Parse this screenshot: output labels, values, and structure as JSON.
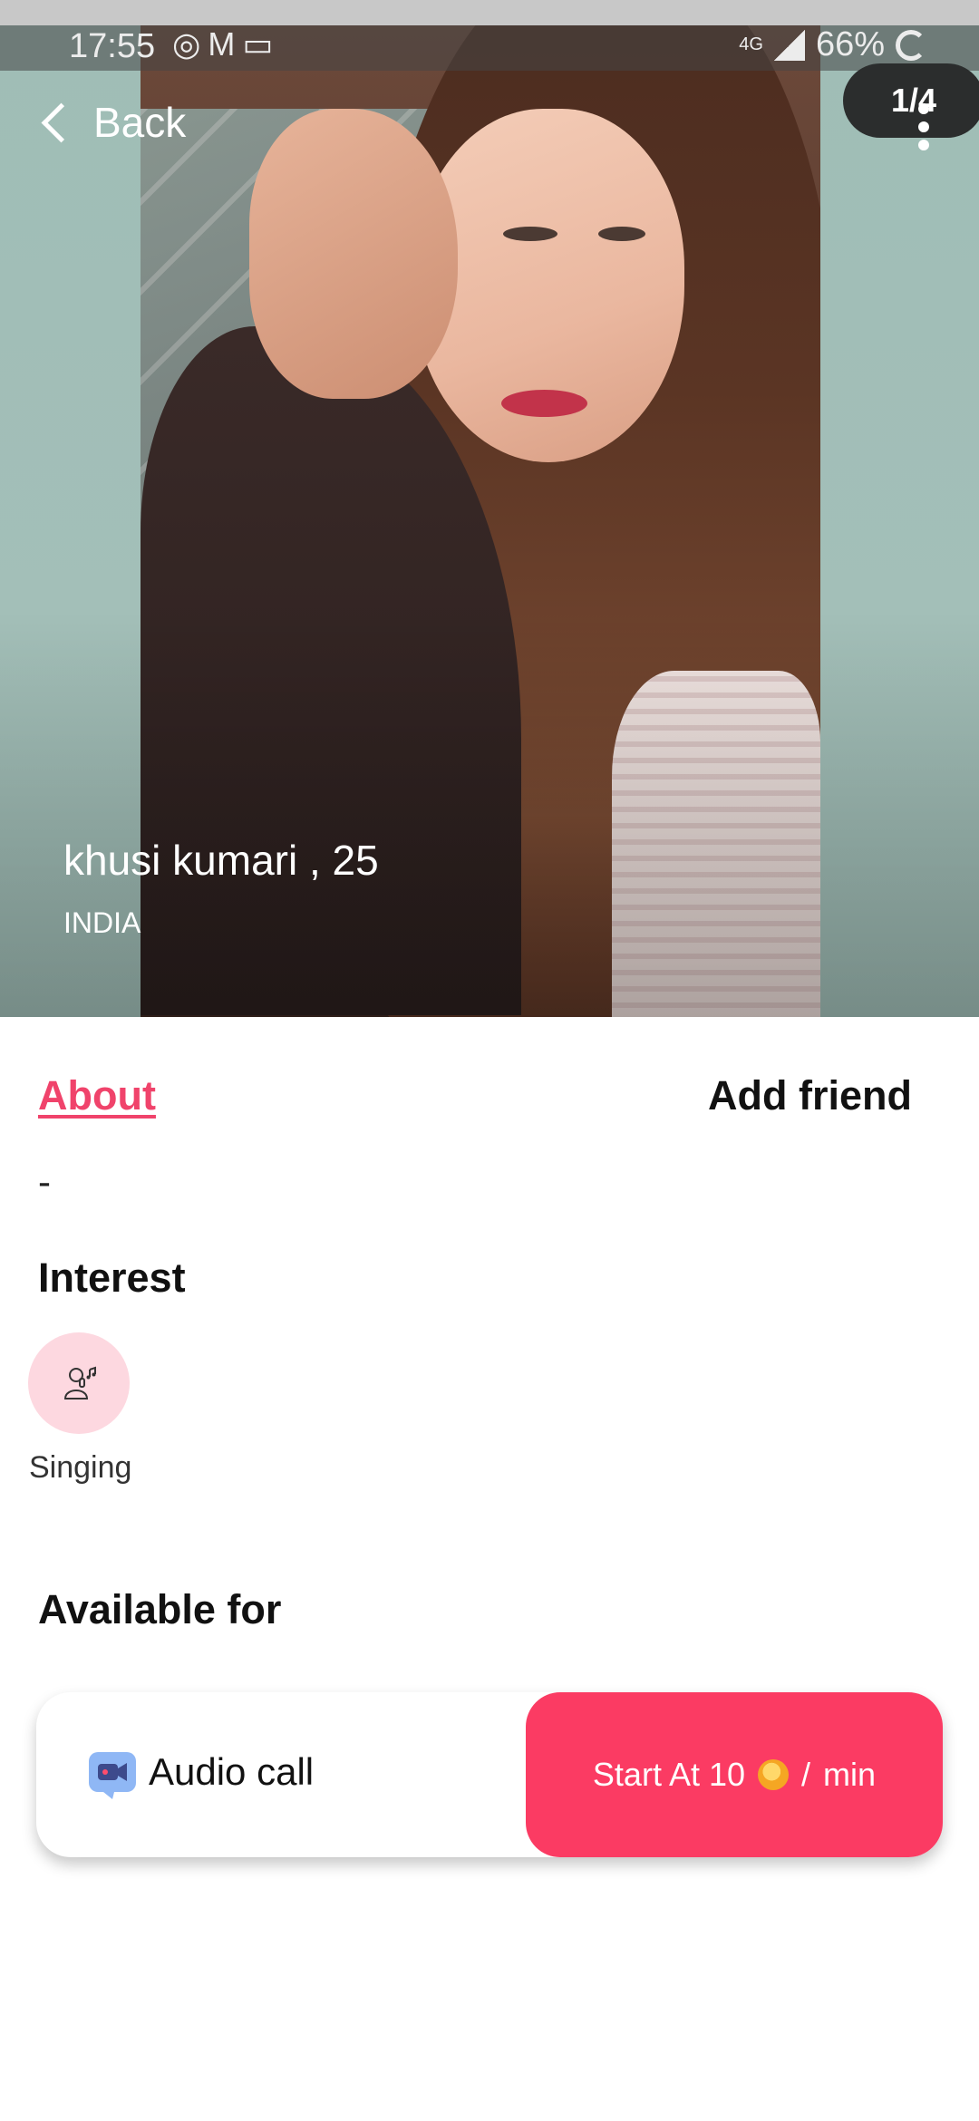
{
  "status_bar": {
    "time": "17:55",
    "icons": [
      "whatsapp-icon",
      "gmail-icon",
      "gallery-icon"
    ],
    "network": "4G",
    "battery": "66%"
  },
  "header": {
    "back_label": "Back",
    "photo_counter": "1/4"
  },
  "profile": {
    "name_age": "khusi kumari , 25",
    "country": "INDIA"
  },
  "tabs": {
    "about": "About",
    "add_friend": "Add friend"
  },
  "about": {
    "text": "-"
  },
  "interest": {
    "title": "Interest",
    "items": [
      {
        "label": "Singing",
        "icon": "singer-icon"
      }
    ]
  },
  "available": {
    "title": "Available for",
    "call_type": "Audio call",
    "start_prefix": "Start At 10",
    "separator": "/",
    "unit": "min"
  },
  "colors": {
    "accent": "#f0436b",
    "button": "#fb3b63",
    "chip": "#fdd8e0",
    "coin": "#f5a623"
  }
}
